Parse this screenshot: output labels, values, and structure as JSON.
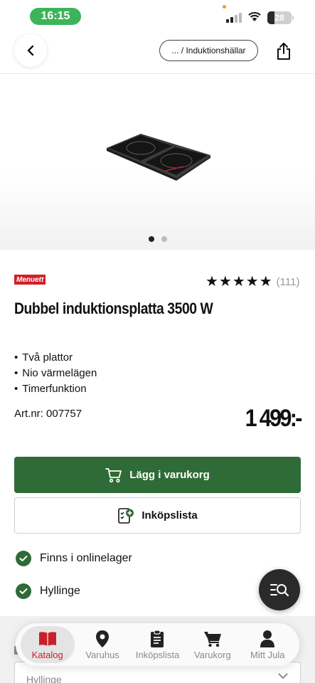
{
  "status_bar": {
    "time": "16:15",
    "battery": "28"
  },
  "header": {
    "breadcrumb": "... / Induktionshällar"
  },
  "product": {
    "brand": "Menuett",
    "rating_stars": 5,
    "rating_count": "(111)",
    "title": "Dubbel induktionsplatta 3500 W",
    "features": [
      "Två plattor",
      "Nio värmelägen",
      "Timerfunktion"
    ],
    "art_nr": "Art.nr: 007757",
    "price": "1 499:-",
    "image_count": 2,
    "image_active_index": 0
  },
  "actions": {
    "add_to_cart": "Lägg i varukorg",
    "shopping_list": "Inköpslista"
  },
  "stock": [
    {
      "label": "Finns i onlinelager"
    },
    {
      "label": "Hyllinge"
    }
  ],
  "store_select": {
    "value": "Hyllinge"
  },
  "bottom_nav": [
    {
      "label": "Katalog",
      "icon": "book-icon",
      "active": true
    },
    {
      "label": "Varuhus",
      "icon": "location-pin-icon",
      "active": false
    },
    {
      "label": "Inköpslista",
      "icon": "clipboard-icon",
      "active": false
    },
    {
      "label": "Varukorg",
      "icon": "cart-icon",
      "active": false
    },
    {
      "label": "Mitt Jula",
      "icon": "person-icon",
      "active": false
    }
  ],
  "colors": {
    "primary_green": "#2f6b37",
    "brand_red": "#c9202a",
    "time_pill": "#3cb55a"
  }
}
